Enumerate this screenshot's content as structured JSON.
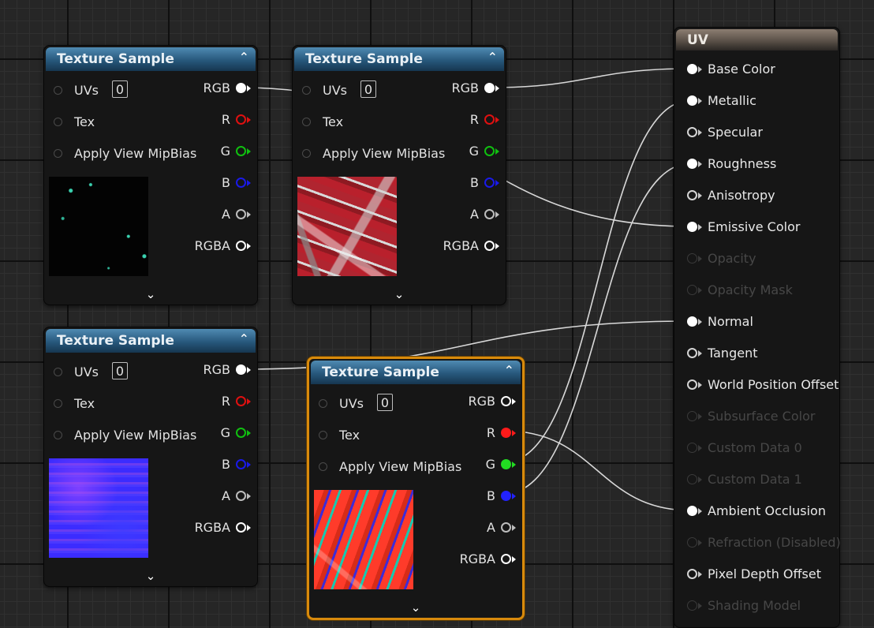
{
  "graph": {
    "nodes": [
      {
        "title": "Texture Sample",
        "collapse_icon": "chevron-up-icon",
        "expand_icon": "chevron-down-icon",
        "uv_value": "0",
        "preview": "black texture with sparse green specks",
        "selected": false,
        "inputs": [
          "UVs",
          "Tex",
          "Apply View MipBias"
        ],
        "outputs": [
          {
            "label": "RGB",
            "color": "#ffffff",
            "connected": true
          },
          {
            "label": "R",
            "color": "#e01010",
            "connected": false
          },
          {
            "label": "G",
            "color": "#10c010",
            "connected": false
          },
          {
            "label": "B",
            "color": "#1a1ae8",
            "connected": false
          },
          {
            "label": "A",
            "color": "#bdbdbd",
            "connected": false
          },
          {
            "label": "RGBA",
            "color": "#ffffff",
            "connected": false
          }
        ]
      },
      {
        "title": "Texture Sample",
        "collapse_icon": "chevron-up-icon",
        "expand_icon": "chevron-down-icon",
        "uv_value": "0",
        "preview": "red and white base color texture",
        "selected": false,
        "inputs": [
          "UVs",
          "Tex",
          "Apply View MipBias"
        ],
        "outputs": [
          {
            "label": "RGB",
            "color": "#ffffff",
            "connected": true
          },
          {
            "label": "R",
            "color": "#e01010",
            "connected": false
          },
          {
            "label": "G",
            "color": "#10c010",
            "connected": false
          },
          {
            "label": "B",
            "color": "#1a1ae8",
            "connected": false
          },
          {
            "label": "A",
            "color": "#bdbdbd",
            "connected": false
          },
          {
            "label": "RGBA",
            "color": "#ffffff",
            "connected": false
          }
        ]
      },
      {
        "title": "Texture Sample",
        "collapse_icon": "chevron-up-icon",
        "expand_icon": "chevron-down-icon",
        "uv_value": "0",
        "preview": "blue normal map texture",
        "selected": false,
        "inputs": [
          "UVs",
          "Tex",
          "Apply View MipBias"
        ],
        "outputs": [
          {
            "label": "RGB",
            "color": "#ffffff",
            "connected": true
          },
          {
            "label": "R",
            "color": "#e01010",
            "connected": false
          },
          {
            "label": "G",
            "color": "#10c010",
            "connected": false
          },
          {
            "label": "B",
            "color": "#1a1ae8",
            "connected": false
          },
          {
            "label": "A",
            "color": "#bdbdbd",
            "connected": false
          },
          {
            "label": "RGBA",
            "color": "#ffffff",
            "connected": false
          }
        ]
      },
      {
        "title": "Texture Sample",
        "collapse_icon": "chevron-up-icon",
        "expand_icon": "chevron-down-icon",
        "uv_value": "0",
        "preview": "multicolor packed ORM texture",
        "selected": true,
        "inputs": [
          "UVs",
          "Tex",
          "Apply View MipBias"
        ],
        "outputs": [
          {
            "label": "RGB",
            "color": "#ffffff",
            "connected": false
          },
          {
            "label": "R",
            "color": "#ff1a1a",
            "connected": true
          },
          {
            "label": "G",
            "color": "#22dd22",
            "connected": true
          },
          {
            "label": "B",
            "color": "#2222ff",
            "connected": true
          },
          {
            "label": "A",
            "color": "#bdbdbd",
            "connected": false
          },
          {
            "label": "RGBA",
            "color": "#ffffff",
            "connected": false
          }
        ]
      }
    ],
    "material": {
      "title": "UV",
      "pins": [
        {
          "label": "Base Color",
          "enabled": true,
          "connected": true
        },
        {
          "label": "Metallic",
          "enabled": true,
          "connected": true
        },
        {
          "label": "Specular",
          "enabled": true,
          "connected": false
        },
        {
          "label": "Roughness",
          "enabled": true,
          "connected": true
        },
        {
          "label": "Anisotropy",
          "enabled": true,
          "connected": false
        },
        {
          "label": "Emissive Color",
          "enabled": true,
          "connected": true
        },
        {
          "label": "Opacity",
          "enabled": false,
          "connected": false
        },
        {
          "label": "Opacity Mask",
          "enabled": false,
          "connected": false
        },
        {
          "label": "Normal",
          "enabled": true,
          "connected": true
        },
        {
          "label": "Tangent",
          "enabled": true,
          "connected": false
        },
        {
          "label": "World Position Offset",
          "enabled": true,
          "connected": false
        },
        {
          "label": "Subsurface Color",
          "enabled": false,
          "connected": false
        },
        {
          "label": "Custom Data 0",
          "enabled": false,
          "connected": false
        },
        {
          "label": "Custom Data 1",
          "enabled": false,
          "connected": false
        },
        {
          "label": "Ambient Occlusion",
          "enabled": true,
          "connected": true
        },
        {
          "label": "Refraction (Disabled)",
          "enabled": false,
          "connected": false
        },
        {
          "label": "Pixel Depth Offset",
          "enabled": true,
          "connected": false
        },
        {
          "label": "Shading Model",
          "enabled": false,
          "connected": false
        }
      ]
    },
    "connections": [
      {
        "from_node": 0,
        "from_pin": "RGB",
        "to_pin": "Emissive Color"
      },
      {
        "from_node": 1,
        "from_pin": "RGB",
        "to_pin": "Base Color"
      },
      {
        "from_node": 2,
        "from_pin": "RGB",
        "to_pin": "Normal"
      },
      {
        "from_node": 3,
        "from_pin": "R",
        "to_pin": "Ambient Occlusion"
      },
      {
        "from_node": 3,
        "from_pin": "G",
        "to_pin": "Metallic"
      },
      {
        "from_node": 3,
        "from_pin": "B",
        "to_pin": "Roughness"
      }
    ]
  }
}
